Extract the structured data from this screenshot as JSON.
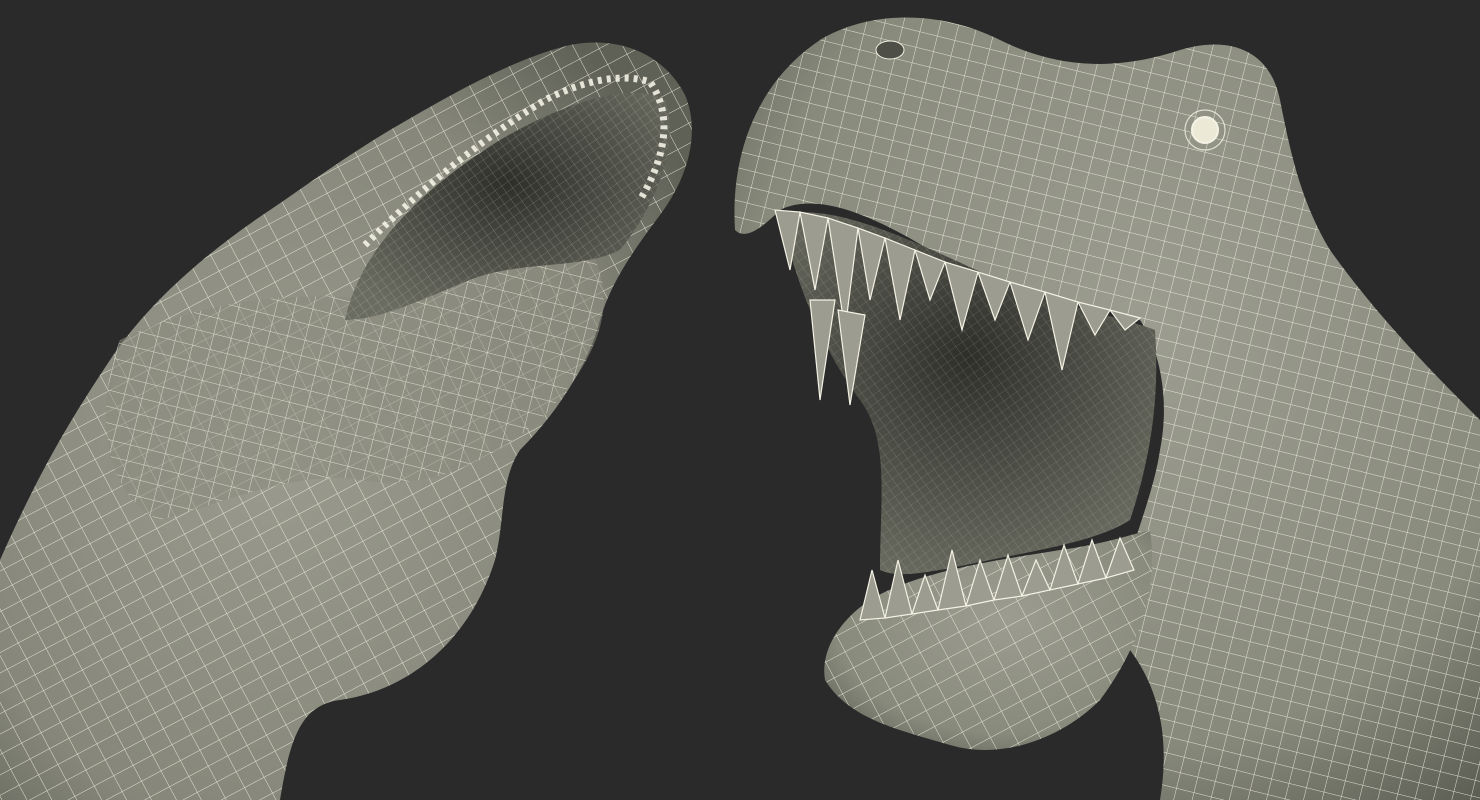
{
  "scene": {
    "description_visible_text": "",
    "background_color": "#2a2a2a",
    "mesh_surface_color": "#8e8f82",
    "mesh_shadow_color": "#5b5c52",
    "mouth_interior_color": "#3b3c35",
    "wireframe_color": "#f4f2e4",
    "eye_color": "#ece9d6",
    "views": [
      {
        "id": "left-view",
        "subject": "t-rex-head-underside-wireframe"
      },
      {
        "id": "right-view",
        "subject": "t-rex-head-open-jaw-wireframe"
      }
    ]
  }
}
